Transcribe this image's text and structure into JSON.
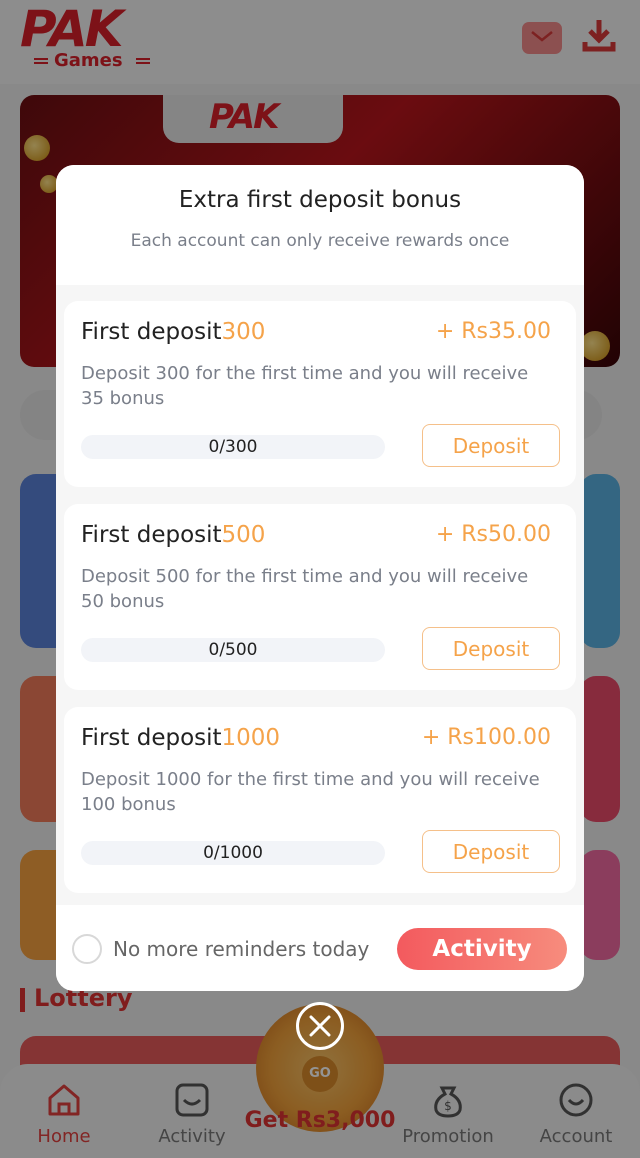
{
  "app": {
    "logo_big": "PAK",
    "logo_small": "Games",
    "icons": {
      "mail": "mail-icon",
      "download": "download-icon"
    }
  },
  "background": {
    "section_title": "Lottery",
    "spin_label": "Get Rs3,000",
    "spin_go": "GO"
  },
  "bottom_nav": [
    {
      "label": "Home",
      "icon": "home-icon",
      "active": true
    },
    {
      "label": "Activity",
      "icon": "activity-icon",
      "active": false
    },
    {
      "label": "Promotion",
      "icon": "money-bag-icon",
      "active": false
    },
    {
      "label": "Account",
      "icon": "account-icon",
      "active": false
    }
  ],
  "modal": {
    "title": "Extra first deposit bonus",
    "subtitle": "Each account can only receive rewards once",
    "cards": [
      {
        "title_prefix": "First deposit",
        "amount": "300",
        "reward": "+ Rs35.00",
        "description": "Deposit 300 for the first time and you will receive 35 bonus",
        "progress_text": "0/300",
        "progress_fraction": 0,
        "button": "Deposit"
      },
      {
        "title_prefix": "First deposit",
        "amount": "500",
        "reward": "+ Rs50.00",
        "description": "Deposit 500 for the first time and you will receive 50 bonus",
        "progress_text": "0/500",
        "progress_fraction": 0,
        "button": "Deposit"
      },
      {
        "title_prefix": "First deposit",
        "amount": "1000",
        "reward": "+ Rs100.00",
        "description": "Deposit 1000 for the first time and you will receive 100 bonus",
        "progress_text": "0/1000",
        "progress_fraction": 0,
        "button": "Deposit"
      }
    ],
    "reminder_label": "No more reminders today",
    "reminder_checked": false,
    "activity_button": "Activity"
  },
  "colors": {
    "accent_orange": "#f5a34a",
    "brand_red": "#d71f2a",
    "activity_gradient": [
      "#f35a5e",
      "#f78c7d"
    ],
    "nav_active": "#e0403f"
  }
}
